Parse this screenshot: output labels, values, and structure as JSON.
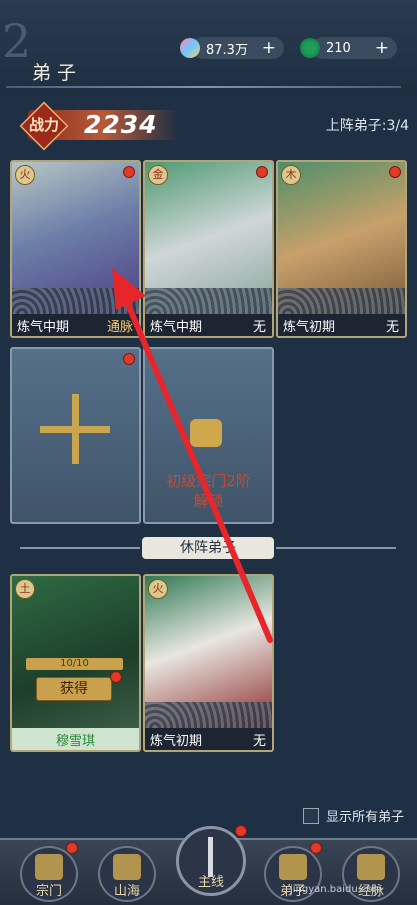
{
  "header": {
    "title": "弟子",
    "deco_char": "2"
  },
  "resources": [
    {
      "icon": "crystal-icon",
      "value": "87.3万",
      "plus": "+"
    },
    {
      "icon": "jade-coin-icon",
      "value": "210",
      "plus": "+"
    }
  ],
  "power": {
    "label": "战力",
    "value": "2234"
  },
  "deploy": {
    "label": "上阵弟子:3/4"
  },
  "active_cards": [
    {
      "element": "火",
      "realm": "炼气中期",
      "trait": "通脉"
    },
    {
      "element": "金",
      "realm": "炼气中期",
      "trait": "无"
    },
    {
      "element": "木",
      "realm": "炼气初期",
      "trait": "无"
    }
  ],
  "locked_slot": {
    "text_line1": "初级宗门2阶",
    "text_line2": "解锁"
  },
  "resting": {
    "header": "休阵弟子"
  },
  "resting_cards": [
    {
      "element": "土",
      "name": "穆雪琪",
      "progress": "10/10",
      "button": "获得"
    },
    {
      "element": "火",
      "realm": "炼气初期",
      "trait": "无"
    }
  ],
  "show_all": {
    "label": "显示所有弟子"
  },
  "nav": [
    {
      "label": "宗门",
      "icon": "pagoda-icon"
    },
    {
      "label": "山海",
      "icon": "mountain-icon"
    },
    {
      "label": "主线",
      "icon": "sword-icon"
    },
    {
      "label": "弟子",
      "icon": "disciple-icon"
    },
    {
      "label": "经脉",
      "icon": "meridian-icon"
    }
  ],
  "watermark": "jingyan.baidu.com",
  "colors": {
    "background": "#1f3044",
    "accent": "#c9a550",
    "alert_dot": "#e23a28",
    "arrow": "#e6262b"
  }
}
